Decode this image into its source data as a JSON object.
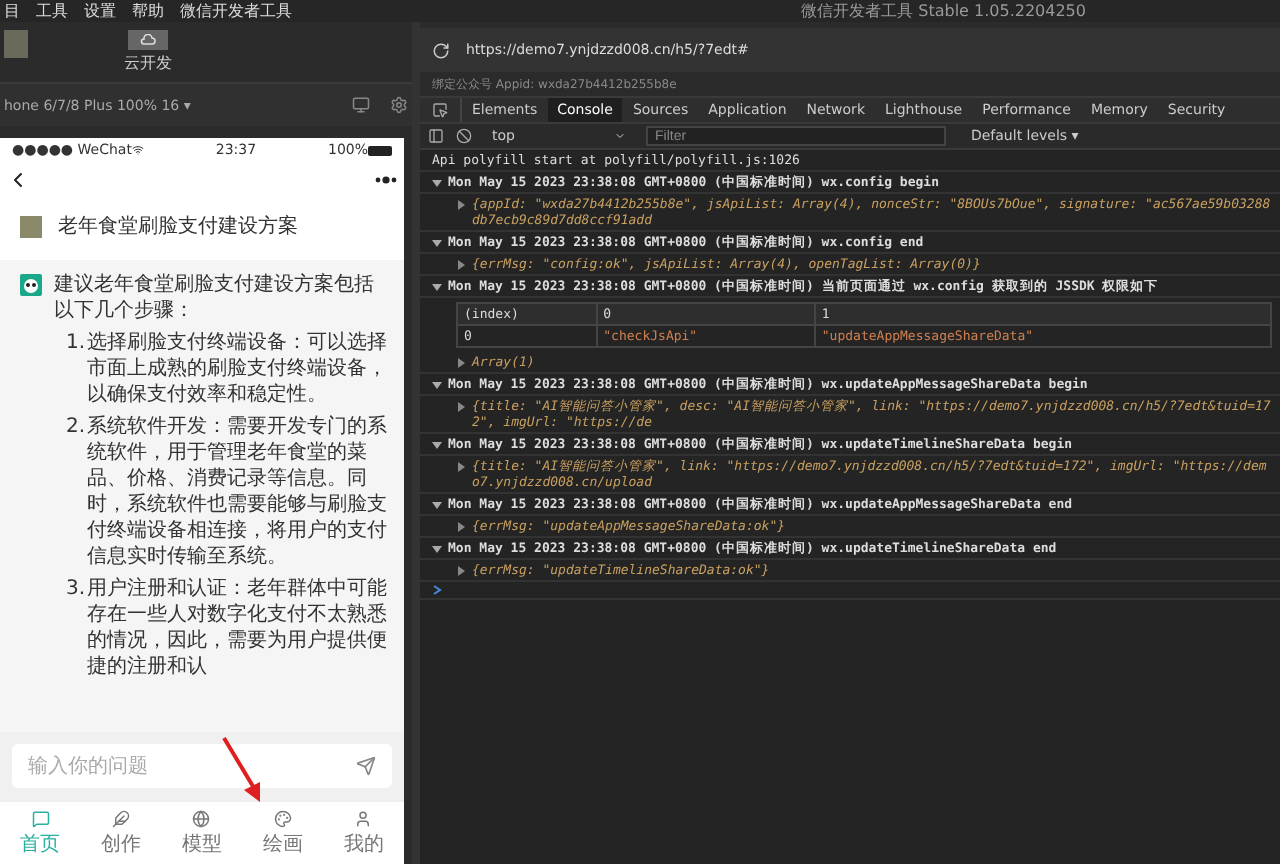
{
  "menu_bar": {
    "items": [
      "目",
      "工具",
      "设置",
      "帮助",
      "微信开发者工具"
    ],
    "title": "微信开发者工具 Stable 1.05.2204250"
  },
  "toolbar": {
    "cloud_button": "云开发"
  },
  "simulator": {
    "device": "hone 6/7/8 Plus 100% 16 ▾"
  },
  "address_bar": {
    "url": "https://demo7.ynjdzzd008.cn/h5/?7edt#",
    "appid": "绑定公众号 Appid: wxda27b4412b255b8e"
  },
  "phone": {
    "status": {
      "carrier": "●●●●● WeChat",
      "time": "23:37",
      "battery": "100%"
    },
    "messages": [
      {
        "kind": "user",
        "text": "老年食堂刷脸支付建设方案"
      },
      {
        "kind": "bot",
        "text": "建议老年食堂刷脸支付建设方案包括以下几个步骤：",
        "steps": [
          {
            "number": "1.",
            "text": "选择刷脸支付终端设备：可以选择市面上成熟的刷脸支付终端设备，以确保支付效率和稳定性。"
          },
          {
            "number": "2.",
            "text": "系统软件开发：需要开发专门的系统软件，用于管理老年食堂的菜品、价格、消费记录等信息。同时，系统软件也需要能够与刷脸支付终端设备相连接，将用户的支付信息实时传输至系统。"
          },
          {
            "number": "3.",
            "text": "用户注册和认证：老年群体中可能存在一些人对数字化支付不太熟悉的情况，因此，需要为用户提供便捷的注册和认"
          }
        ]
      }
    ],
    "input": {
      "placeholder": "输入你的问题"
    },
    "tabs": [
      {
        "label": "首页",
        "selected": true
      },
      {
        "label": "创作",
        "selected": false
      },
      {
        "label": "模型",
        "selected": false
      },
      {
        "label": "绘画",
        "selected": false
      },
      {
        "label": "我的",
        "selected": false
      }
    ]
  },
  "devtools": {
    "tabs": [
      {
        "label": "Elements",
        "selected": false
      },
      {
        "label": "Console",
        "selected": true
      },
      {
        "label": "Sources",
        "selected": false
      },
      {
        "label": "Application",
        "selected": false
      },
      {
        "label": "Network",
        "selected": false
      },
      {
        "label": "Lighthouse",
        "selected": false
      },
      {
        "label": "Performance",
        "selected": false
      },
      {
        "label": "Memory",
        "selected": false
      },
      {
        "label": "Security",
        "selected": false
      }
    ],
    "context": "top",
    "filter_placeholder": "Filter",
    "levels": "Default levels ▾",
    "console": [
      {
        "kind": "log",
        "text": "Api polyfill start  at polyfill/polyfill.js:1026"
      },
      {
        "kind": "group",
        "expanded": true,
        "text": "Mon May 15 2023 23:38:08 GMT+0800 (中国标准时间) wx.config begin"
      },
      {
        "kind": "object",
        "text": "{appId: \"wxda27b4412b255b8e\", jsApiList: Array(4), nonceStr: \"8BOUs7bOue\", signature: \"ac567ae59b03288db7ecb9c89d7dd8ccf91add"
      },
      {
        "kind": "group",
        "expanded": true,
        "text": "Mon May 15 2023 23:38:08 GMT+0800 (中国标准时间) wx.config end"
      },
      {
        "kind": "object",
        "text": "{errMsg: \"config:ok\", jsApiList: Array(4), openTagList: Array(0)}"
      },
      {
        "kind": "group",
        "expanded": true,
        "text": "Mon May 15 2023 23:38:08 GMT+0800 (中国标准时间) 当前页面通过 wx.config 获取到的 JSSDK 权限如下"
      },
      {
        "kind": "table",
        "columns": [
          "(index)",
          "0",
          "1"
        ],
        "rows": [
          [
            "0",
            "\"checkJsApi\"",
            "\"updateAppMessageShareData\""
          ]
        ]
      },
      {
        "kind": "object",
        "text": "Array(1)"
      },
      {
        "kind": "group",
        "expanded": true,
        "text": "Mon May 15 2023 23:38:08 GMT+0800 (中国标准时间) wx.updateAppMessageShareData begin"
      },
      {
        "kind": "object",
        "text": "{title: \"AI智能问答小管家\", desc: \"AI智能问答小管家\", link: \"https://demo7.ynjdzzd008.cn/h5/?7edt&tuid=172\", imgUrl: \"https://de"
      },
      {
        "kind": "group",
        "expanded": true,
        "text": "Mon May 15 2023 23:38:08 GMT+0800 (中国标准时间) wx.updateTimelineShareData begin"
      },
      {
        "kind": "object",
        "text": "{title: \"AI智能问答小管家\", link: \"https://demo7.ynjdzzd008.cn/h5/?7edt&tuid=172\", imgUrl: \"https://demo7.ynjdzzd008.cn/upload"
      },
      {
        "kind": "group",
        "expanded": true,
        "text": "Mon May 15 2023 23:38:08 GMT+0800 (中国标准时间) wx.updateAppMessageShareData end"
      },
      {
        "kind": "object",
        "text": "{errMsg: \"updateAppMessageShareData:ok\"}"
      },
      {
        "kind": "group",
        "expanded": true,
        "text": "Mon May 15 2023 23:38:08 GMT+0800 (中国标准时间) wx.updateTimelineShareData end"
      },
      {
        "kind": "object",
        "text": "{errMsg: \"updateTimelineShareData:ok\"}"
      },
      {
        "kind": "prompt"
      }
    ]
  }
}
